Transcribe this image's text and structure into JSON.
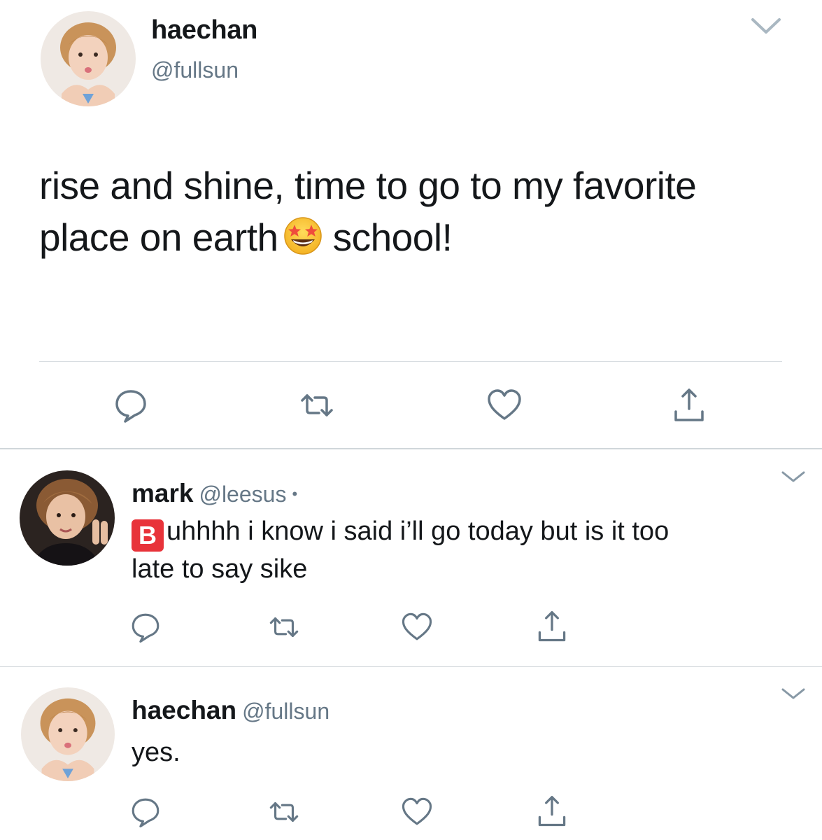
{
  "main_tweet": {
    "name": "haechan",
    "handle": "@fullsun",
    "text_line1": "rise and shine, time to go to my favorite",
    "text_line2_before": "place on earth",
    "emoji": "star-struck-emoji",
    "text_line2_after": "school!"
  },
  "replies": [
    {
      "name": "mark",
      "handle": "@leesus",
      "dot": "•",
      "emoji_letter": "B",
      "text_line1": "uhhhh i know i said i’ll go today but is it too",
      "text_line2": "late to say sike"
    },
    {
      "name": "haechan",
      "handle": "@fullsun",
      "text_line1": "yes."
    }
  ],
  "colors": {
    "text_primary": "#14171a",
    "text_secondary": "#657786",
    "icon": "#657786",
    "divider": "#d0d6da",
    "emoji_b_bg": "#e8333a"
  },
  "icons": [
    "reply-icon",
    "retweet-icon",
    "like-icon",
    "share-icon",
    "chevron-down-icon"
  ]
}
